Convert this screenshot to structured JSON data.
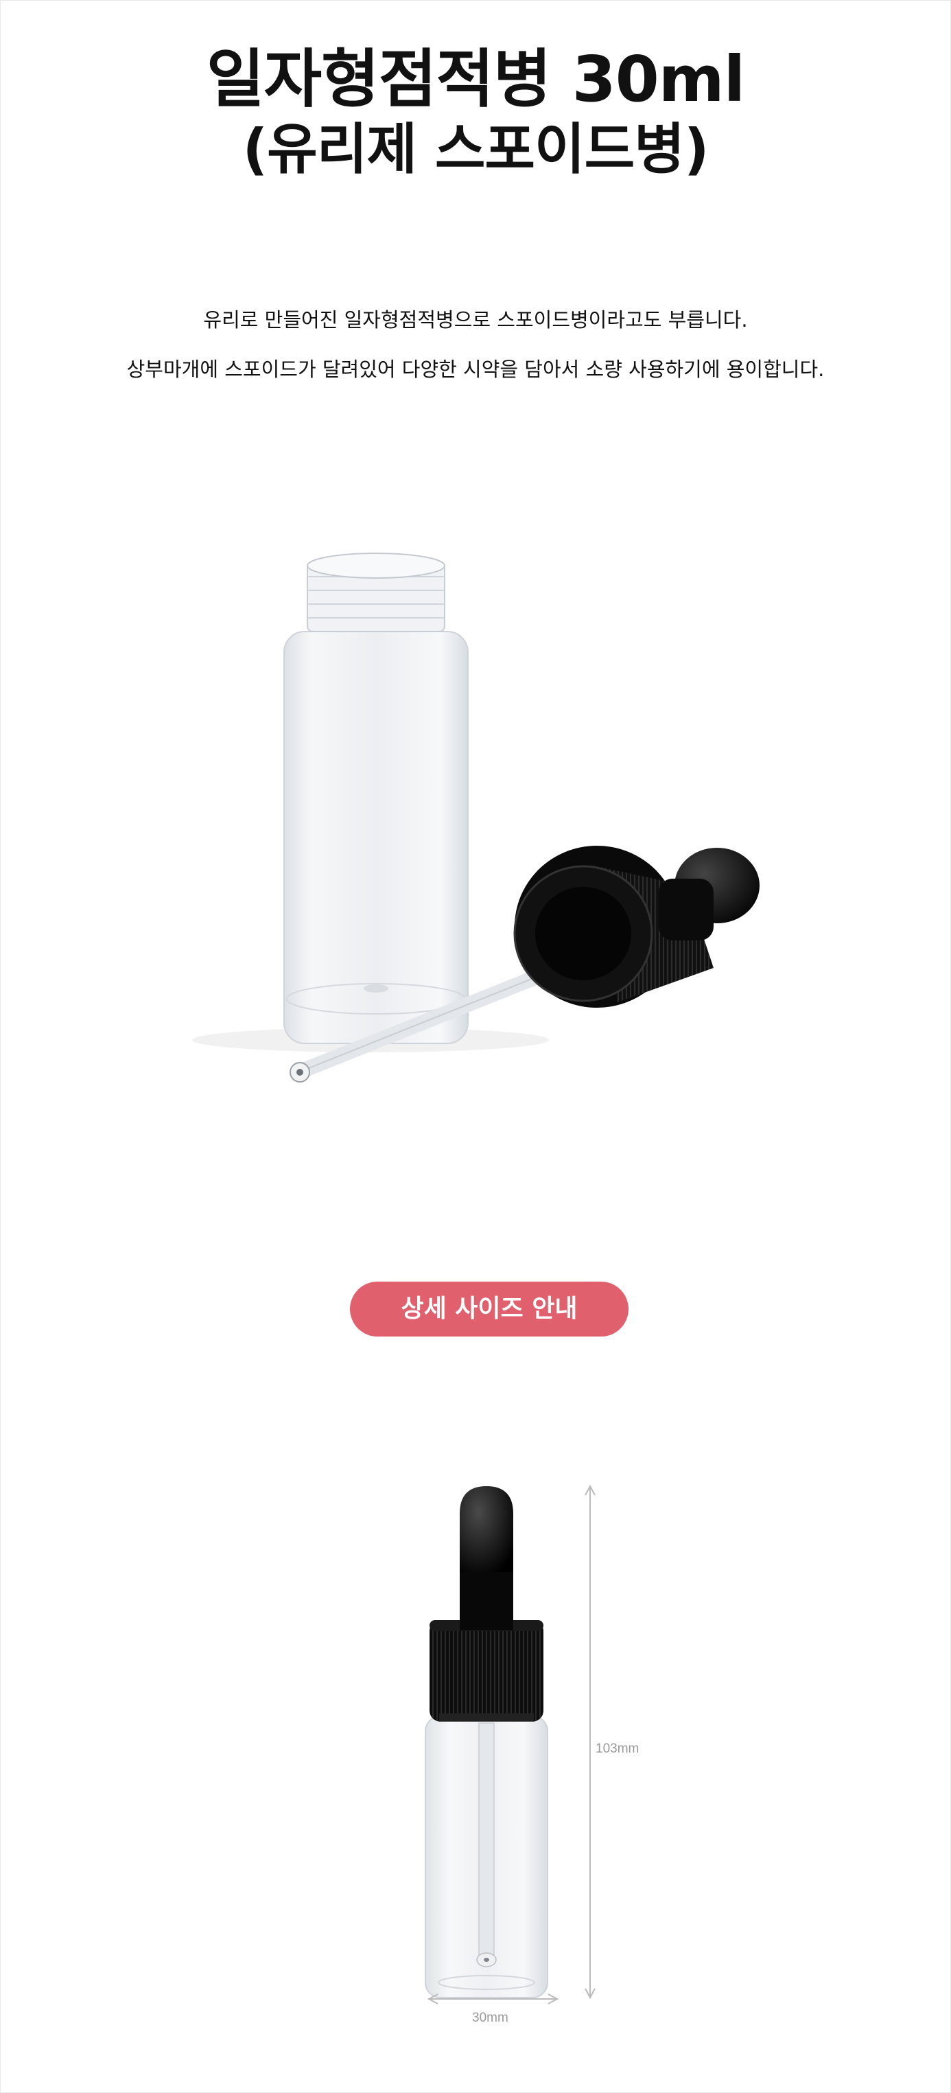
{
  "title": {
    "line1": "일자형점적병 30ml",
    "line2": "(유리제 스포이드병)"
  },
  "description": {
    "line1": "유리로 만들어진 일자형점적병으로 스포이드병이라고도 부릅니다.",
    "line2": "상부마개에 스포이드가 달려있어 다양한 시약을 담아서 소량 사용하기에 용이합니다."
  },
  "size_guide": {
    "badge_label": "상세 사이즈 안내",
    "height_label": "103mm",
    "width_label": "30mm"
  },
  "colors": {
    "badge": "#e0606e",
    "cap": "#111111",
    "glass": "#eef0f3",
    "dimension_line": "#bbbbbb"
  }
}
